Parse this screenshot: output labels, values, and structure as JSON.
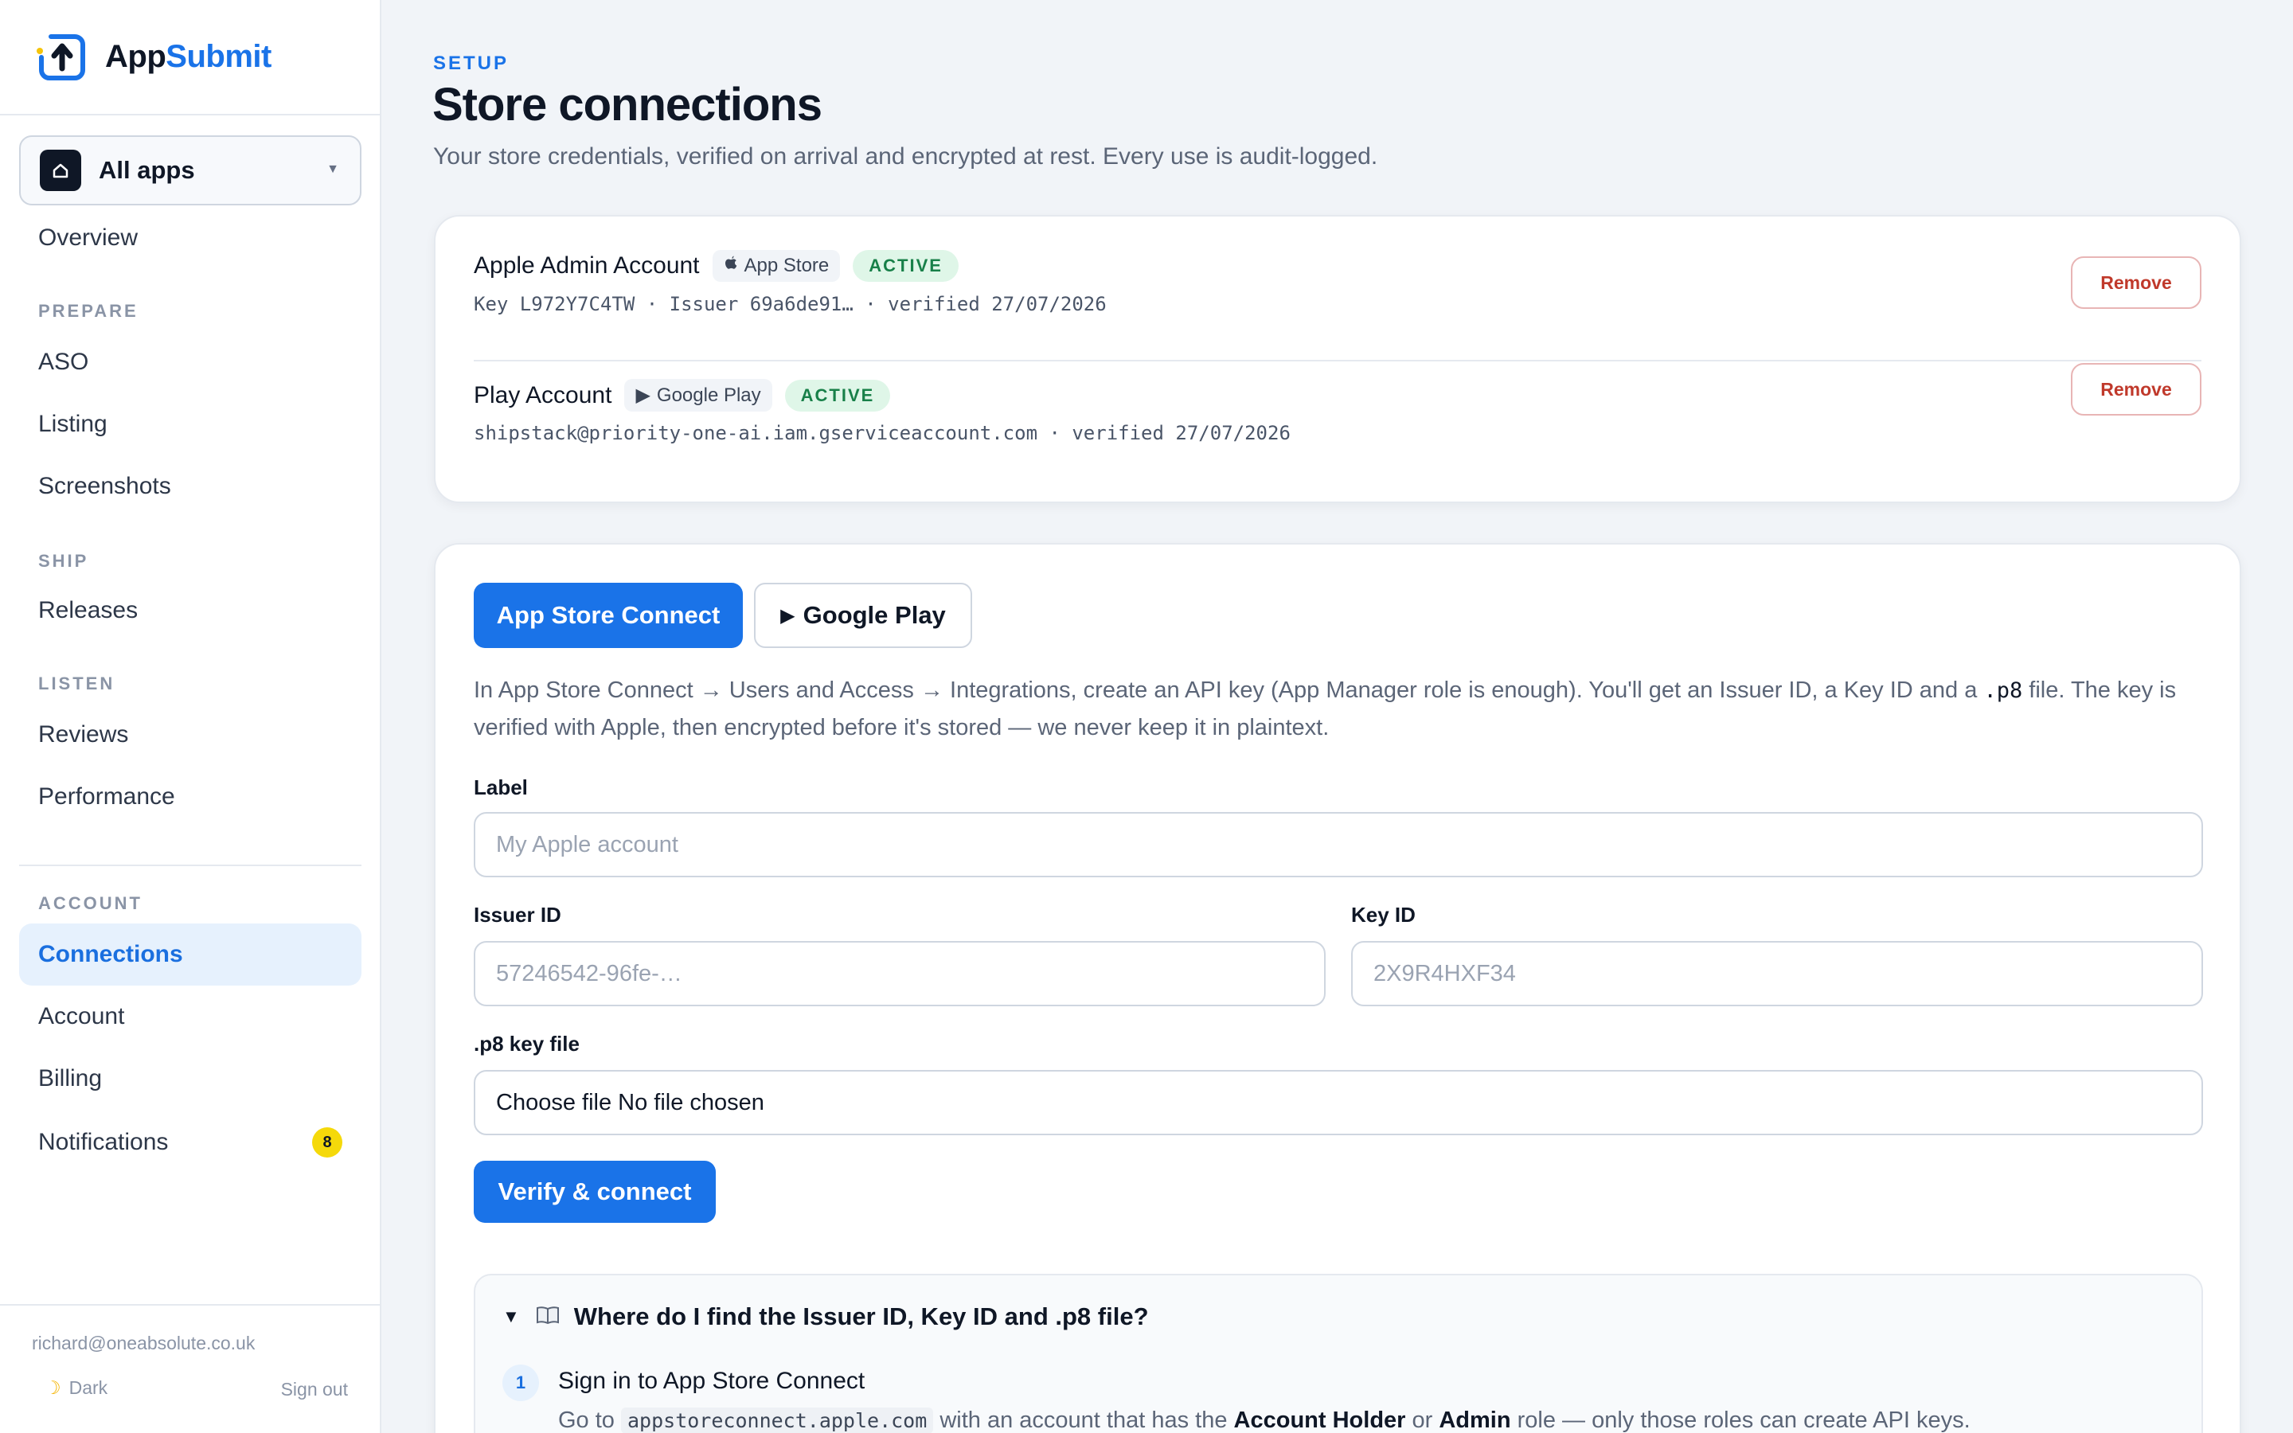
{
  "brand": {
    "name_part1": "App",
    "name_part2": "Submit",
    "accent": "#1a73e8"
  },
  "app_switcher": {
    "label": "All apps",
    "icon": "home-icon"
  },
  "nav": {
    "overview": "Overview",
    "prepare_heading": "PREPARE",
    "aso": "ASO",
    "listing": "Listing",
    "screenshots": "Screenshots",
    "ship_heading": "SHIP",
    "releases": "Releases",
    "listen_heading": "LISTEN",
    "reviews": "Reviews",
    "performance": "Performance",
    "account_heading": "ACCOUNT",
    "connections": "Connections",
    "account": "Account",
    "billing": "Billing",
    "notifications": "Notifications",
    "notifications_count": "8"
  },
  "footer": {
    "email": "richard@oneabsolute.co.uk",
    "theme": "Dark",
    "sign_out": "Sign out"
  },
  "header": {
    "eyebrow": "SETUP",
    "title": "Store connections",
    "subtitle": "Your store credentials, verified on arrival and encrypted at rest. Every use is audit-logged."
  },
  "connections": [
    {
      "name": "Apple Admin Account",
      "store": "App Store",
      "store_icon": "apple-icon",
      "status": "ACTIVE",
      "meta": "Key L972Y7C4TW · Issuer 69a6de91… · verified 27/07/2026",
      "remove_label": "Remove"
    },
    {
      "name": "Play Account",
      "store": "Google Play",
      "store_icon": "play-icon",
      "status": "ACTIVE",
      "meta": "shipstack@priority-one-ai.iam.gserviceaccount.com · verified 27/07/2026",
      "remove_label": "Remove"
    }
  ],
  "tabs": {
    "app_store_connect": "App Store Connect",
    "google_play": "Google Play"
  },
  "help": {
    "part1": "In App Store Connect → Users and Access → Integrations, create an API key (App Manager role is enough). You'll get an Issuer ID, a Key ID and a ",
    "code": ".p8",
    "part2": " file. The key is verified with Apple, then encrypted before it's stored — we never keep it in plaintext."
  },
  "form": {
    "label_label": "Label",
    "label_placeholder": "My Apple account",
    "issuer_label": "Issuer ID",
    "issuer_placeholder": "57246542-96fe-…",
    "key_label": "Key ID",
    "key_placeholder": "2X9R4HXF34",
    "p8_label": ".p8 key file",
    "p8_value": "Choose file No file chosen",
    "submit": "Verify & connect"
  },
  "guide": {
    "summary": "Where do I find the Issuer ID, Key ID and .p8 file?",
    "step_number": "1",
    "step_title": "Sign in to App Store Connect",
    "step_pre": "Go to ",
    "step_code": "appstoreconnect.apple.com",
    "step_mid": " with an account that has the ",
    "step_bold1": "Account Holder",
    "step_or": " or ",
    "step_bold2": "Admin",
    "step_post": " role — only those roles can create API keys."
  }
}
